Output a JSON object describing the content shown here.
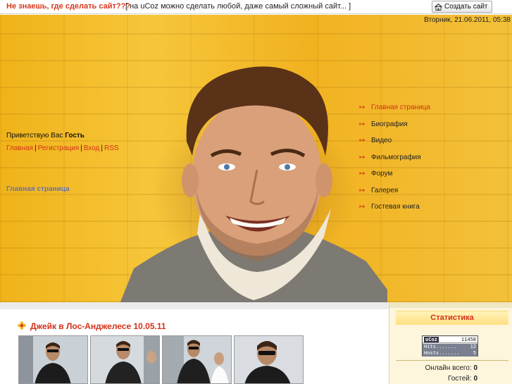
{
  "topbar": {
    "promo_question": "Не знаешь, где сделать сайт???",
    "promo_text": "[ на uCoz можно сделать любой, даже самый сложный сайт... ]",
    "create_site_label": "Создать сайт",
    "create_site_icon": "house-icon"
  },
  "header": {
    "date": "Вторник, 21.06.2011, 05:38",
    "welcome_prefix": "Приветствую Вас",
    "welcome_user": "Гость",
    "user_links": [
      "Главная",
      "Регистрация",
      "Вход",
      "RSS"
    ],
    "page_title": "Главная страница"
  },
  "menu": {
    "arrow_icon": "double-arrow-icon",
    "items": [
      {
        "label": "Главная страница",
        "active": true
      },
      {
        "label": "Биография",
        "active": false
      },
      {
        "label": "Видео",
        "active": false
      },
      {
        "label": "Фильмография",
        "active": false
      },
      {
        "label": "Форум",
        "active": false
      },
      {
        "label": "Галерея",
        "active": false
      },
      {
        "label": "Гостевая книга",
        "active": false
      }
    ]
  },
  "news": {
    "icon": "flower-icon",
    "title": "Джейк в Лос-Анджелесе 10.05.11",
    "thumbnails": 4
  },
  "sidebar": {
    "stats_title": "Статистика",
    "counter": {
      "brand": "uCoz",
      "total": "11458",
      "hits_label": "Hits.......",
      "hits_value": "12",
      "hosts_label": "Hosts.......",
      "hosts_value": "5"
    },
    "online_total_label": "Онлайн всего:",
    "online_total_value": "0",
    "guests_label": "Гостей:",
    "guests_value": "0"
  },
  "colors": {
    "accent": "#d4301a",
    "page_title": "#6b74a8",
    "header_yellow": "#f2b824",
    "sidebar_bg": "#fdf6dd"
  }
}
